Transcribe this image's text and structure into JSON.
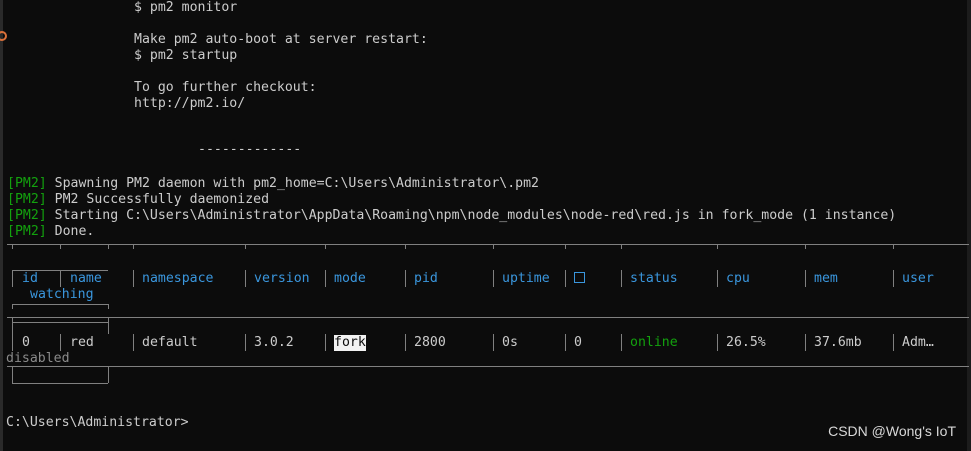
{
  "intro": {
    "monitor_cmd": "$ pm2 monitor",
    "autoboot_title": "Make pm2 auto-boot at server restart:",
    "startup_cmd": "$ pm2 startup",
    "further_title": "To go further checkout:",
    "url": "http://pm2.io/",
    "separator": "-------------"
  },
  "logs": [
    {
      "tag": "[PM2]",
      "msg": " Spawning PM2 daemon with pm2_home=C:\\Users\\Administrator\\.pm2"
    },
    {
      "tag": "[PM2]",
      "msg": " PM2 Successfully daemonized"
    },
    {
      "tag": "[PM2]",
      "msg": " Starting C:\\Users\\Administrator\\AppData\\Roaming\\npm\\node_modules\\node-red\\red.js in fork_mode (1 instance)"
    },
    {
      "tag": "[PM2]",
      "msg": " Done."
    }
  ],
  "table": {
    "headers": {
      "id": "id",
      "name": "name",
      "watching": "watching",
      "namespace": "namespace",
      "version": "version",
      "mode": "mode",
      "pid": "pid",
      "uptime": "uptime",
      "status": "status",
      "cpu": "cpu",
      "mem": "mem",
      "user": "user"
    },
    "row": {
      "id": "0",
      "name": "red",
      "namespace": "default",
      "version": "3.0.2",
      "mode": "fork",
      "pid": "2800",
      "uptime": "0s",
      "restarts": "0",
      "status": "online",
      "cpu": "26.5%",
      "mem": "37.6mb",
      "user": "Adm…",
      "watching": "disabled"
    }
  },
  "prompt": "C:\\Users\\Administrator>",
  "watermark": "CSDN @Wong's IoT",
  "colors": {
    "background": "#0c0c0c",
    "text": "#cccccc",
    "tag_green": "#13a10e",
    "header_blue": "#3a96dd",
    "border_gray": "#808080"
  }
}
